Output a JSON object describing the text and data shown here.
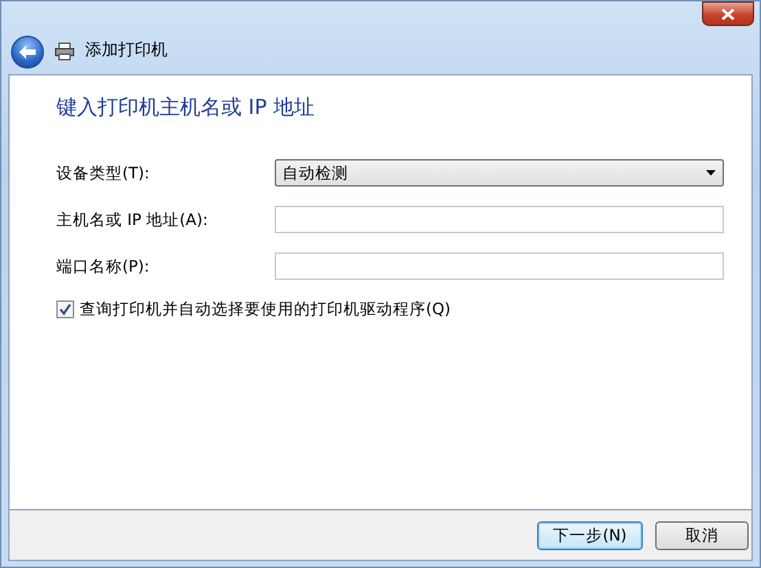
{
  "window": {
    "title": "添加打印机"
  },
  "heading": "键入打印机主机名或 IP 地址",
  "fields": [
    {
      "kind": "dropdown",
      "label": "设备类型(T):",
      "value": "自动检测"
    },
    {
      "kind": "text",
      "label": "主机名或 IP 地址(A):"
    },
    {
      "kind": "text",
      "label": "端口名称(P):"
    }
  ],
  "checkbox": {
    "label": "查询打印机并自动选择要使用的打印机驱动程序(Q)",
    "checked": true
  },
  "buttons": [
    {
      "label": "下一步(N)",
      "default": true
    },
    {
      "label": "取消",
      "default": false
    }
  ]
}
